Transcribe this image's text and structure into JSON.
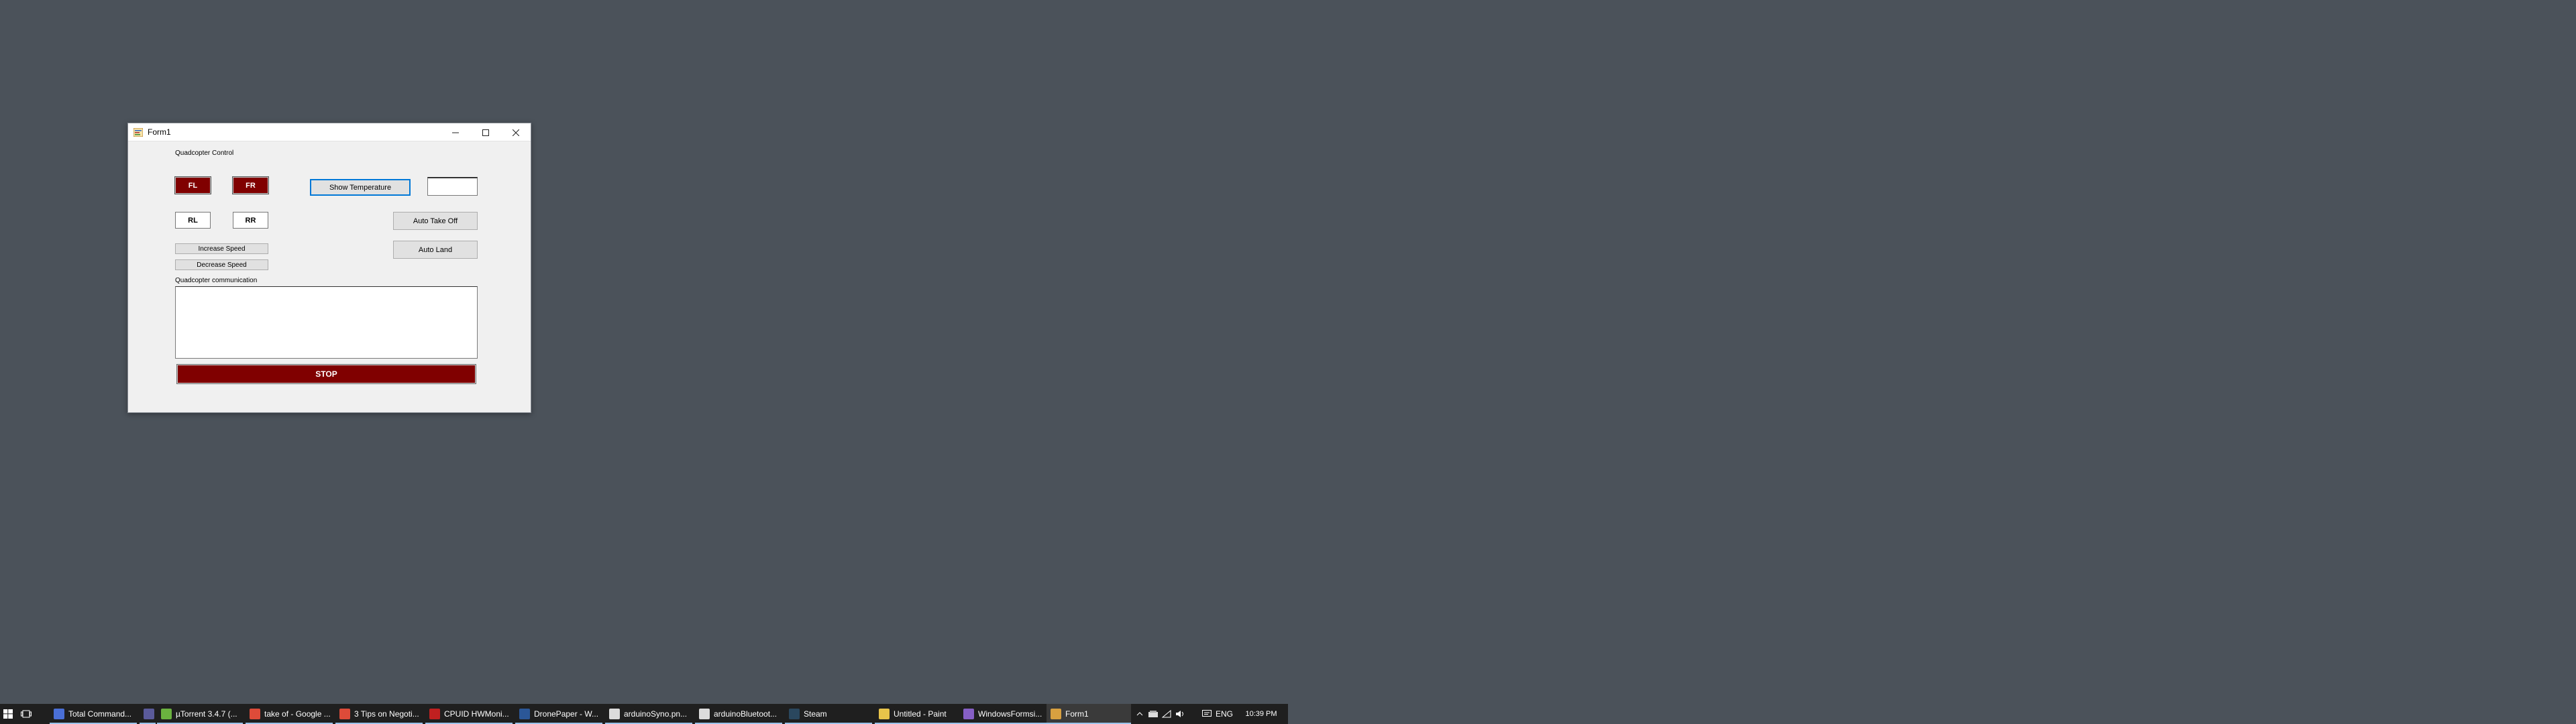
{
  "window": {
    "title": "Form1",
    "controls": {
      "minimize": "–",
      "maximize": "☐",
      "close": "✕"
    }
  },
  "form": {
    "heading": "Quadcopter Control",
    "motors": {
      "fl": "FL",
      "fr": "FR",
      "rl": "RL",
      "rr": "RR"
    },
    "show_temperature": "Show Temperature",
    "temperature_value": "",
    "auto_take_off": "Auto Take Off",
    "auto_land": "Auto Land",
    "increase_speed": "Increase Speed",
    "decrease_speed": "Decrease Speed",
    "comm_label": "Quadcopter communication",
    "comm_text": "",
    "stop": "STOP"
  },
  "colors": {
    "desktop": "#4b525a",
    "motor_active": "#800000",
    "stop": "#800000",
    "focus": "#0078d7"
  },
  "taskbar": {
    "items": [
      {
        "label": "Total Command...",
        "icon": "total-commander-icon",
        "color": "#4a6fd6"
      },
      {
        "label": "",
        "icon": "app-circle-icon",
        "color": "#5a5a9a"
      },
      {
        "label": "µTorrent 3.4.7 (...",
        "icon": "utorrent-icon",
        "color": "#6ab23f"
      },
      {
        "label": "take of - Google ...",
        "icon": "chrome-icon",
        "color": "#dd4b39"
      },
      {
        "label": "3 Tips on Negoti...",
        "icon": "chrome-icon",
        "color": "#dd4b39"
      },
      {
        "label": "CPUID HWMoni...",
        "icon": "hwmonitor-icon",
        "color": "#c02020"
      },
      {
        "label": "DronePaper - W...",
        "icon": "word-icon",
        "color": "#2b5797"
      },
      {
        "label": "arduinoSyno.pn...",
        "icon": "image-file-icon",
        "color": "#dcdcdc"
      },
      {
        "label": "arduinoBluetoot...",
        "icon": "image-file-icon",
        "color": "#dcdcdc"
      },
      {
        "label": "Steam",
        "icon": "steam-icon",
        "color": "#2a475e"
      },
      {
        "label": "Untitled - Paint",
        "icon": "paint-icon",
        "color": "#e8c44a"
      },
      {
        "label": "WindowsFormsi...",
        "icon": "visual-studio-icon",
        "color": "#865fc5"
      },
      {
        "label": "Form1",
        "icon": "form-app-icon",
        "color": "#d8a040"
      }
    ],
    "tray": {
      "language": "ENG",
      "time": "10:39 PM"
    }
  }
}
